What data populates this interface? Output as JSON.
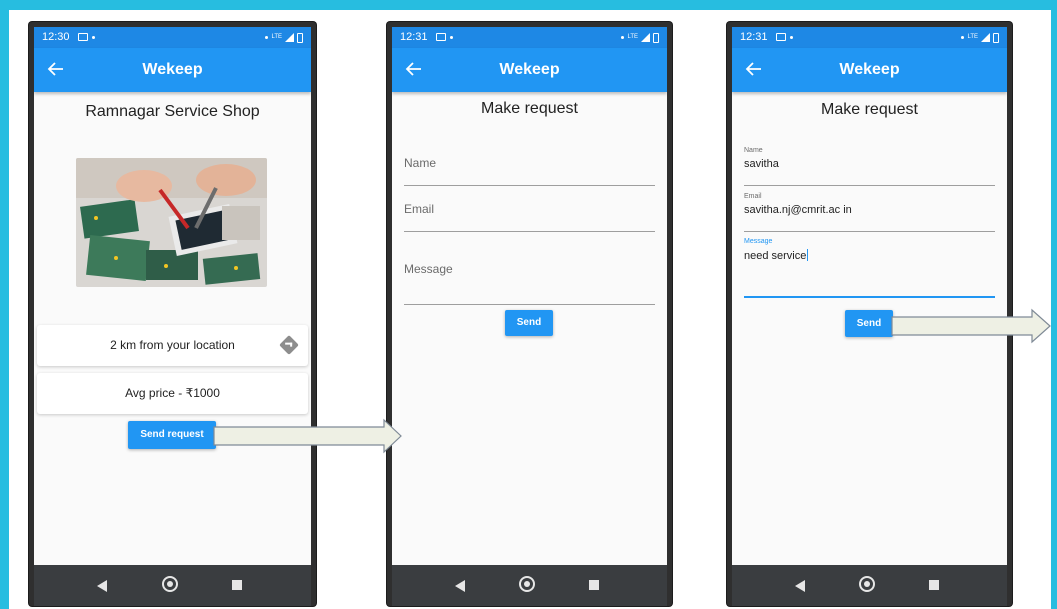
{
  "screens": [
    {
      "status_time": "12:30",
      "app_title": "Wekeep",
      "shop_name": "Ramnagar Service Shop",
      "distance_text": "2 km from your location",
      "price_text": "Avg price - ₹1000",
      "send_request_label": "Send request"
    },
    {
      "status_time": "12:31",
      "app_title": "Wekeep",
      "heading": "Make request",
      "name_label": "Name",
      "email_label": "Email",
      "message_label": "Message",
      "send_label": "Send"
    },
    {
      "status_time": "12:31",
      "app_title": "Wekeep",
      "heading": "Make request",
      "name_label": "Name",
      "name_value": "savitha",
      "email_label": "Email",
      "email_value": "savitha.nj@cmrit.ac in",
      "message_label": "Message",
      "message_value": "need service",
      "send_label": "Send"
    }
  ],
  "status_network": "LTE",
  "colors": {
    "frame": "#27bde0",
    "appbar": "#2196f3",
    "statusbar": "#1e88e5",
    "navbar": "#3a3d40",
    "arrow_fill": "#eef0e4"
  },
  "icons": [
    "back-arrow-icon",
    "directions-icon",
    "nav-back-icon",
    "nav-home-icon",
    "nav-recents-icon",
    "flow-arrow-icon"
  ]
}
